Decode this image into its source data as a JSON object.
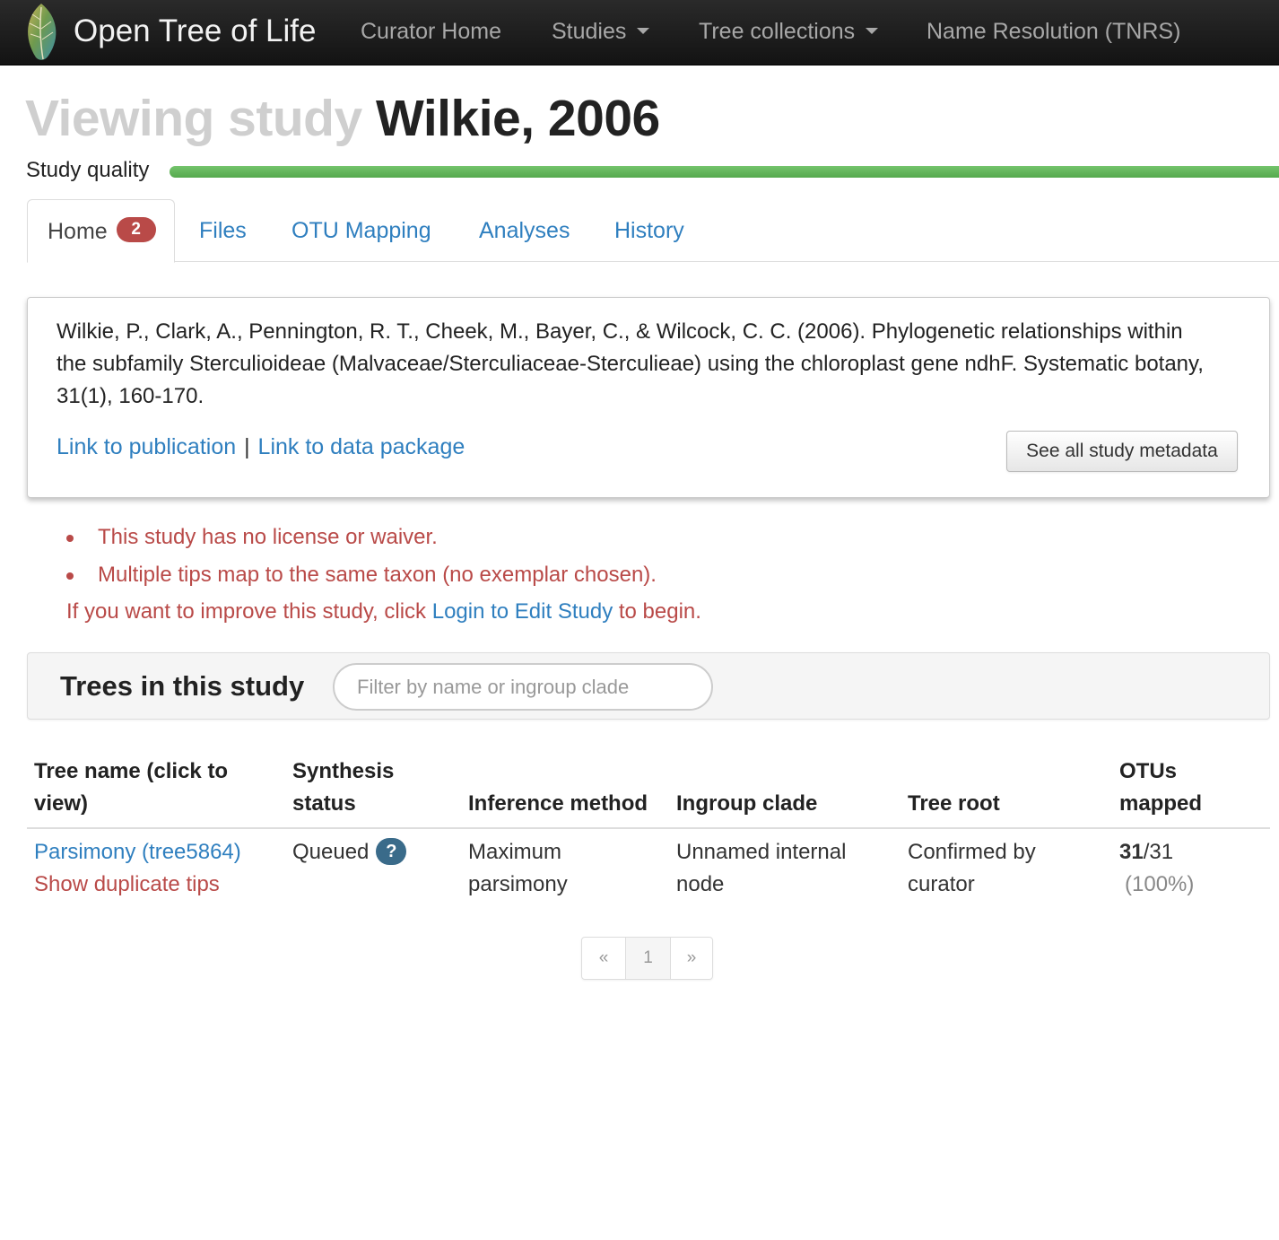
{
  "navbar": {
    "brand": "Open Tree of Life",
    "links": {
      "curator_home": "Curator Home",
      "studies": "Studies",
      "tree_collections": "Tree collections",
      "name_resolution": "Name Resolution (TNRS)"
    }
  },
  "header": {
    "prefix": "Viewing study",
    "study_name": "Wilkie, 2006",
    "quality_label": "Study quality",
    "quality_fraction": 1.0,
    "quality_color": "#5cb85c"
  },
  "tabs": {
    "home": "Home",
    "home_badge": "2",
    "files": "Files",
    "otu_mapping": "OTU Mapping",
    "analyses": "Analyses",
    "history": "History"
  },
  "publication": {
    "citation": "Wilkie, P., Clark, A., Pennington, R. T., Cheek, M., Bayer, C., & Wilcock, C. C. (2006). Phylogenetic relationships within the subfamily Sterculioideae (Malvaceae/Sterculiaceae-Sterculieae) using the chloroplast gene ndhF. Systematic botany, 31(1), 160-170.",
    "link_publication": "Link to publication",
    "separator": "|",
    "link_data_package": "Link to data package",
    "metadata_button": "See all study metadata"
  },
  "warnings": {
    "items": [
      "This study has no license or waiver.",
      "Multiple tips map to the same taxon (no exemplar chosen)."
    ],
    "improve_prefix": "If you want to improve this study, click ",
    "improve_link": "Login to Edit Study",
    "improve_suffix": " to begin."
  },
  "trees": {
    "title": "Trees in this study",
    "filter_placeholder": "Filter by name or ingroup clade",
    "columns": {
      "tree_name": "Tree name (click to view)",
      "synthesis_status": "Synthesis status",
      "inference_method": "Inference method",
      "ingroup_clade": "Ingroup clade",
      "tree_root": "Tree root",
      "otus_mapped": "OTUs mapped"
    },
    "rows": [
      {
        "name": "Parsimony (tree5864)",
        "duplicate_link": "Show duplicate tips",
        "status": "Queued",
        "status_help": "?",
        "method": "Maximum parsimony",
        "ingroup": "Unnamed internal node",
        "root": "Confirmed by curator",
        "mapped": "31",
        "total": "/31",
        "percent": "(100%)"
      }
    ]
  },
  "pagination": {
    "prev": "«",
    "page": "1",
    "next": "»"
  }
}
